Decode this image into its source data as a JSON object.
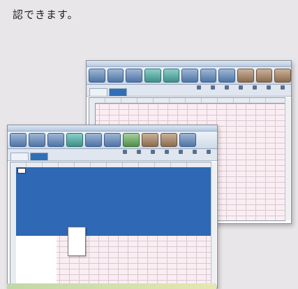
{
  "caption": "認できます。",
  "colors": {
    "background": "#e9e6e9",
    "selection": "#2f68b4",
    "grid_pink": "#fbeef3",
    "ribbon_blue": "#4f74a6"
  },
  "back_window": {
    "tabs": [
      {
        "label": ""
      },
      {
        "label": ""
      }
    ],
    "ribbon_buttons": [
      "",
      "",
      "",
      "",
      "",
      "",
      "",
      "",
      "",
      "",
      ""
    ],
    "column_headers": [
      "",
      "",
      "",
      "",
      "",
      "",
      "",
      "",
      "",
      "",
      ""
    ]
  },
  "front_window": {
    "tabs": [
      {
        "label": ""
      },
      {
        "label": ""
      }
    ],
    "ribbon_buttons": [
      "",
      "",
      "",
      "",
      "",
      "",
      "",
      "",
      "",
      ""
    ],
    "column_headers": [
      "",
      "",
      "",
      "",
      "",
      "",
      "",
      "",
      "",
      "",
      ""
    ],
    "context_menu": [
      "",
      "",
      "",
      "",
      "",
      "",
      ""
    ]
  },
  "icons": [
    "ribbon-button-icon",
    "toolbar-icon",
    "scrollbar"
  ]
}
